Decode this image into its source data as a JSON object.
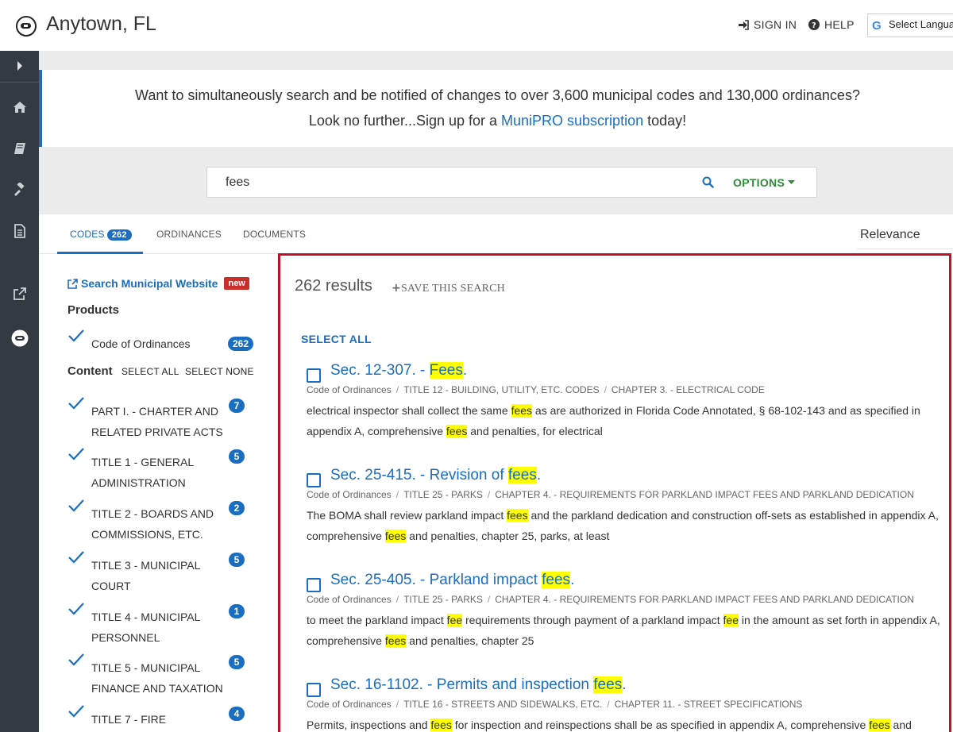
{
  "header": {
    "site_title": "Anytown, FL",
    "sign_in": "SIGN IN",
    "help": "HELP",
    "language": "Select Language"
  },
  "banner": {
    "line1": "Want to simultaneously search and be notified of changes to over 3,600 municipal codes and 130,000 ordinances?",
    "line2_prefix": "Look no further...Sign up for a ",
    "line2_link": "MuniPRO subscription",
    "line2_suffix": " today!"
  },
  "search": {
    "query": "fees",
    "options_label": "OPTIONS"
  },
  "tabs": {
    "codes_label": "CODES",
    "codes_count": "262",
    "ordinances_label": "ORDINANCES",
    "documents_label": "DOCUMENTS",
    "sort_label": "Relevance"
  },
  "sidebar": {
    "ext_link": "Search Municipal Website",
    "new_badge": "new",
    "products_heading": "Products",
    "products": [
      {
        "label": "Code of Ordinances",
        "count": "262"
      }
    ],
    "content_heading": "Content",
    "select_all": "SELECT ALL",
    "select_none": "SELECT NONE",
    "content": [
      {
        "line1": "PART I. - CHARTER AND",
        "line2": "RELATED PRIVATE ACTS",
        "count": "7"
      },
      {
        "line1": "TITLE 1 - GENERAL",
        "line2": "ADMINISTRATION",
        "count": "5"
      },
      {
        "line1": "TITLE 2 - BOARDS AND",
        "line2": "COMMISSIONS, ETC.",
        "count": "2"
      },
      {
        "line1": "TITLE 3 - MUNICIPAL",
        "line2": "COURT",
        "count": "5"
      },
      {
        "line1": "TITLE 4 - MUNICIPAL",
        "line2": "PERSONNEL",
        "count": "1"
      },
      {
        "line1": "TITLE 5 - MUNICIPAL",
        "line2": "FINANCE AND TAXATION",
        "count": "5"
      },
      {
        "line1": "TITLE 7 - FIRE",
        "line2": "",
        "count": "4"
      }
    ]
  },
  "results": {
    "count_text": "262 results",
    "save_search": "SAVE THIS SEARCH",
    "select_all": "SELECT ALL",
    "items": [
      {
        "title_prefix": "Sec. 12-307. - ",
        "title_hl": "Fees",
        "title_suffix": ".",
        "path": [
          "Code of Ordinances",
          "TITLE 12 - BUILDING, UTILITY, ETC. CODES",
          "CHAPTER 3. - ELECTRICAL CODE"
        ],
        "snippet": [
          {
            "t": "electrical inspector shall collect the same "
          },
          {
            "h": "fees"
          },
          {
            "t": " as are authorized in Florida Code Annotated, § 68-102-143 and as specified in appendix A, comprehensive "
          },
          {
            "h": "fees"
          },
          {
            "t": " and penalties, for electrical"
          }
        ]
      },
      {
        "title_prefix": "Sec. 25-415. - Revision of ",
        "title_hl": "fees",
        "title_suffix": ".",
        "path": [
          "Code of Ordinances",
          "TITLE 25 - PARKS",
          "CHAPTER 4. - REQUIREMENTS FOR PARKLAND IMPACT FEES AND PARKLAND DEDICATION"
        ],
        "snippet": [
          {
            "t": "The BOMA shall review parkland impact "
          },
          {
            "h": "fees"
          },
          {
            "t": " and the parkland dedication and construction off-sets as established in appendix A, comprehensive "
          },
          {
            "h": "fees"
          },
          {
            "t": " and penalties, chapter 25, parks, at least"
          }
        ]
      },
      {
        "title_prefix": "Sec. 25-405. - Parkland impact ",
        "title_hl": "fees",
        "title_suffix": ".",
        "path": [
          "Code of Ordinances",
          "TITLE 25 - PARKS",
          "CHAPTER 4. - REQUIREMENTS FOR PARKLAND IMPACT FEES AND PARKLAND DEDICATION"
        ],
        "snippet": [
          {
            "t": "to meet the parkland impact "
          },
          {
            "h": "fee"
          },
          {
            "t": " requirements through payment of a parkland impact "
          },
          {
            "h": "fee"
          },
          {
            "t": " in the amount as set forth in appendix A, comprehensive "
          },
          {
            "h": "fees"
          },
          {
            "t": " and penalties, chapter 25"
          }
        ]
      },
      {
        "title_prefix": "Sec. 16-1102. - Permits and inspection ",
        "title_hl": "fees",
        "title_suffix": ".",
        "path": [
          "Code of Ordinances",
          "TITLE 16 - STREETS AND SIDEWALKS, ETC.",
          "CHAPTER 11. - STREET SPECIFICATIONS"
        ],
        "snippet": [
          {
            "t": "Permits, inspections and "
          },
          {
            "h": "fees"
          },
          {
            "t": " for inspection and reinspections shall be as specified in appendix A, comprehensive "
          },
          {
            "h": "fees"
          },
          {
            "t": " and"
          }
        ]
      }
    ]
  },
  "colors": {
    "link_blue": "#1a6ec1",
    "highlight": "#ffff00",
    "options_green": "#2e8b3a",
    "rail": "#333a42",
    "results_border": "#c0102a",
    "new_badge": "#c9302c"
  },
  "icons": {
    "rail": [
      "chevron-right-icon",
      "home-icon",
      "book-icon",
      "gavel-icon",
      "document-icon",
      "external-link-icon",
      "municode-logo-icon"
    ]
  }
}
